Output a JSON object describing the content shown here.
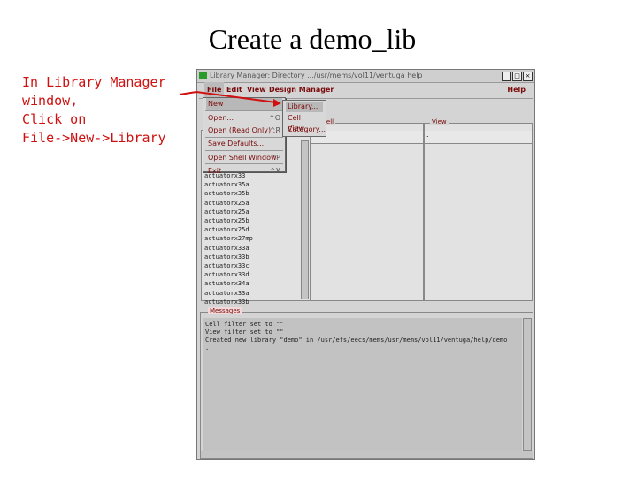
{
  "slide": {
    "title": "Create a demo_lib",
    "note": "In Library Manager\nwindow,\nClick on\nFile->New->Library"
  },
  "window": {
    "title": "Library Manager: Directory .../usr/mems/vol11/ventuga help",
    "minimize": "_",
    "maximize": "□",
    "close": "×"
  },
  "menubar": {
    "file": "File",
    "edit": "Edit",
    "view": "View",
    "design_manager": "Design Manager",
    "help": "Help"
  },
  "file_menu": [
    {
      "label": "New",
      "accel": ""
    },
    {
      "label": "Open...",
      "accel": "^O"
    },
    {
      "label": "Open (Read Only)...",
      "accel": "^R"
    },
    {
      "label": "Save Defaults...",
      "accel": ""
    },
    {
      "label": "Open Shell Window",
      "accel": "^P"
    },
    {
      "label": "Exit",
      "accel": "^X"
    }
  ],
  "new_submenu": [
    "Library...",
    "Cell View...",
    "Category..."
  ],
  "panels": {
    "cell": "Cell",
    "view": "View",
    "view_value": "."
  },
  "library_list": [
    "actuatorx33",
    "actuatorx35a",
    "actuatorx35b",
    "actuatorx25a",
    "actuatorx25a",
    "actuatorx25b",
    "actuatorx25d",
    "actuatorx27mp",
    "actuatorx33a",
    "actuatorx33b",
    "actuatorx33c",
    "actuatorx33d",
    "actuatorx34a",
    "actuatorx33a",
    "actuatorx33b"
  ],
  "messages": {
    "label": "Messages",
    "lines": [
      "Cell filter set to \"\"",
      "View filter set to \"\"",
      "Created new library \"demo\" in /usr/efs/eecs/mems/usr/mems/vol11/ventuga/help/demo",
      "."
    ]
  },
  "colors": {
    "menu_text": "#7a0a0a",
    "annotation": "#d01010"
  }
}
